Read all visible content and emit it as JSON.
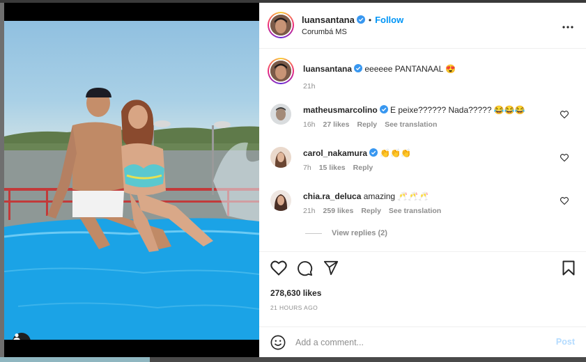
{
  "post": {
    "author": "luansantana",
    "follow_label": "Follow",
    "location": "Corumbá MS"
  },
  "caption": {
    "username": "luansantana",
    "text": "eeeeee PANTANAAL 😍",
    "time": "21h"
  },
  "comments": [
    {
      "username": "matheusmarcolino",
      "verified": true,
      "text": "E peixe?????? Nada????? 😂😂😂",
      "time": "16h",
      "likes": "27 likes",
      "reply": "Reply",
      "translate": "See translation"
    },
    {
      "username": "carol_nakamura",
      "verified": true,
      "text": "👏👏👏",
      "time": "7h",
      "likes": "15 likes",
      "reply": "Reply"
    },
    {
      "username": "chia.ra_deluca",
      "verified": false,
      "text": "amazing 🥂🥂🥂",
      "time": "21h",
      "likes": "259 likes",
      "reply": "Reply",
      "translate": "See translation"
    }
  ],
  "view_replies": "View replies (2)",
  "likes_count": "278,630 likes",
  "posted_ago": "21 HOURS AGO",
  "add_comment": {
    "placeholder": "Add a comment...",
    "post_label": "Post"
  },
  "colors": {
    "accent": "#0095f6",
    "verified": "#3897f0",
    "post_disabled": "#b3dbff"
  },
  "icons": [
    "more-options-icon",
    "like-icon",
    "comment-icon",
    "share-icon",
    "save-icon",
    "emoji-icon",
    "user-tag-icon",
    "verified-icon"
  ]
}
